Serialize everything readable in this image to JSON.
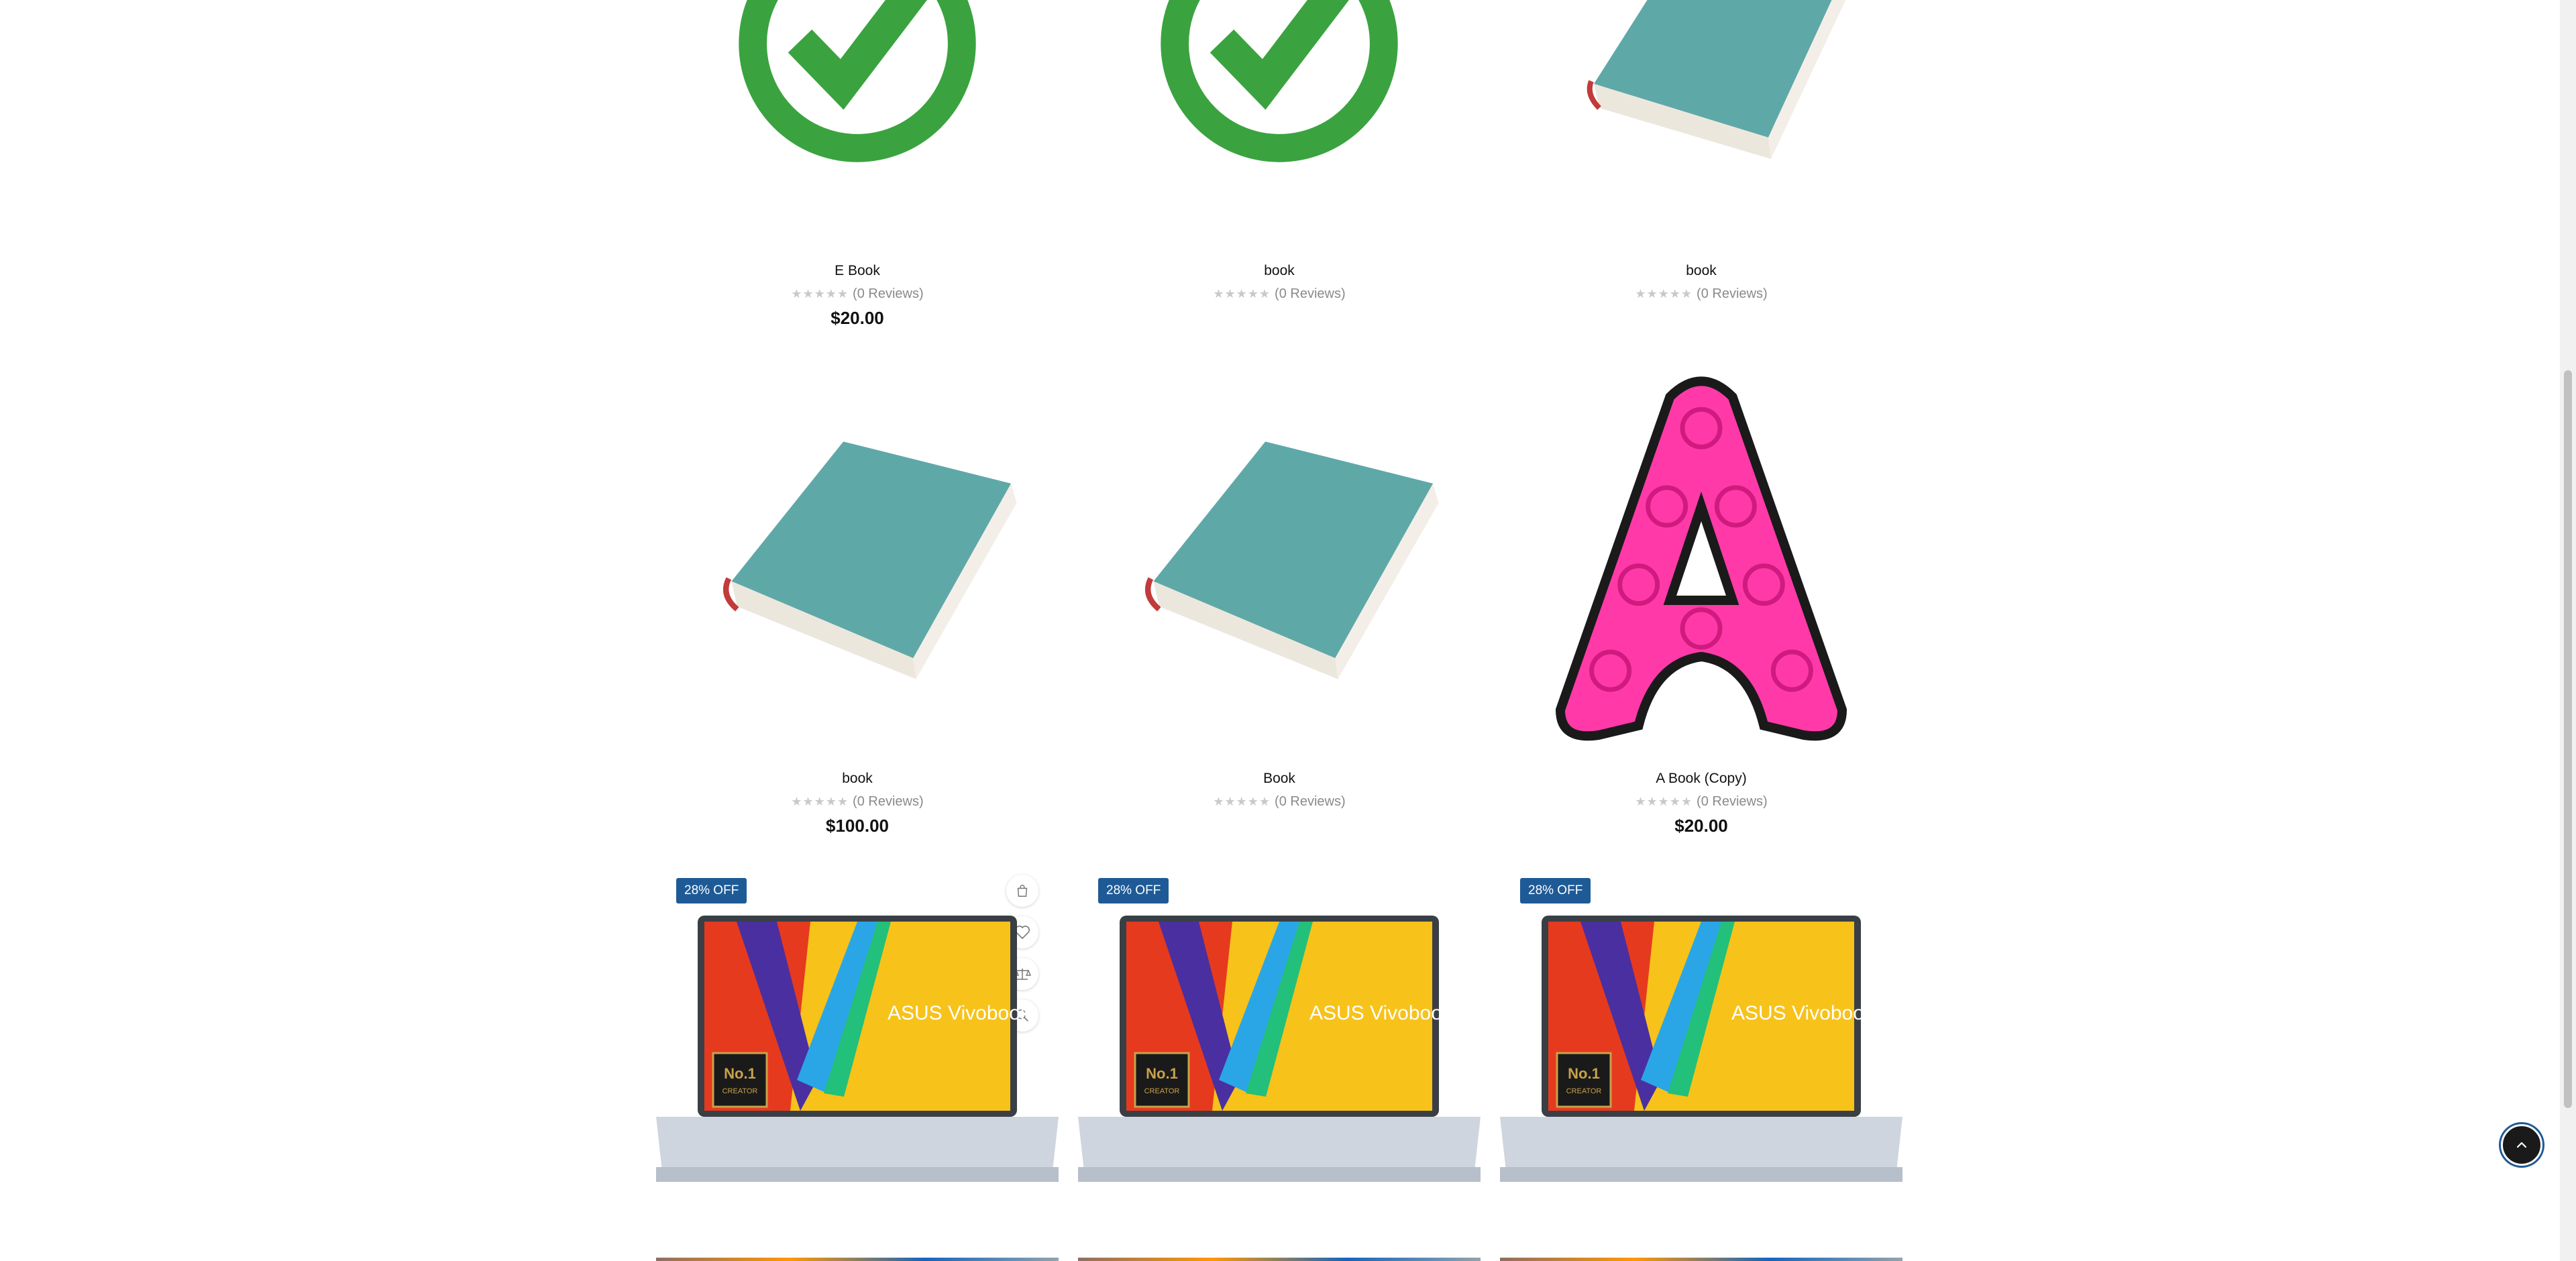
{
  "products_row1": [
    {
      "title": "E Book",
      "reviews": "(0 Reviews)",
      "price": "$20.00",
      "image_icon": "checkmark-circle-icon"
    },
    {
      "title": "book",
      "reviews": "(0 Reviews)",
      "price": "",
      "image_icon": "checkmark-circle-icon"
    },
    {
      "title": "book",
      "reviews": "(0 Reviews)",
      "price": "",
      "image_icon": "book-icon"
    }
  ],
  "products_row2": [
    {
      "title": "book",
      "reviews": "(0 Reviews)",
      "price": "$100.00",
      "image_icon": "book-icon"
    },
    {
      "title": "Book",
      "reviews": "(0 Reviews)",
      "price": "",
      "image_icon": "book-icon"
    },
    {
      "title": "A Book (Copy)",
      "reviews": "(0 Reviews)",
      "price": "$20.00",
      "image_icon": "letter-a-icon"
    }
  ],
  "products_row3": [
    {
      "badge": "28% OFF",
      "laptop_brand": "ASUS Vivobook"
    },
    {
      "badge": "28% OFF",
      "laptop_brand": "ASUS Vivobook"
    },
    {
      "badge": "28% OFF",
      "laptop_brand": "ASUS Vivobook"
    }
  ],
  "laptop_badge": {
    "line1": "No.1",
    "line2": "CREATOR"
  },
  "rating_value": "0 of 5 stars",
  "colors": {
    "check_green": "#3aa33f",
    "book_teal": "#5fa8a8",
    "letter_pink": "#ff3aa8",
    "badge_blue": "#1e5a96"
  }
}
